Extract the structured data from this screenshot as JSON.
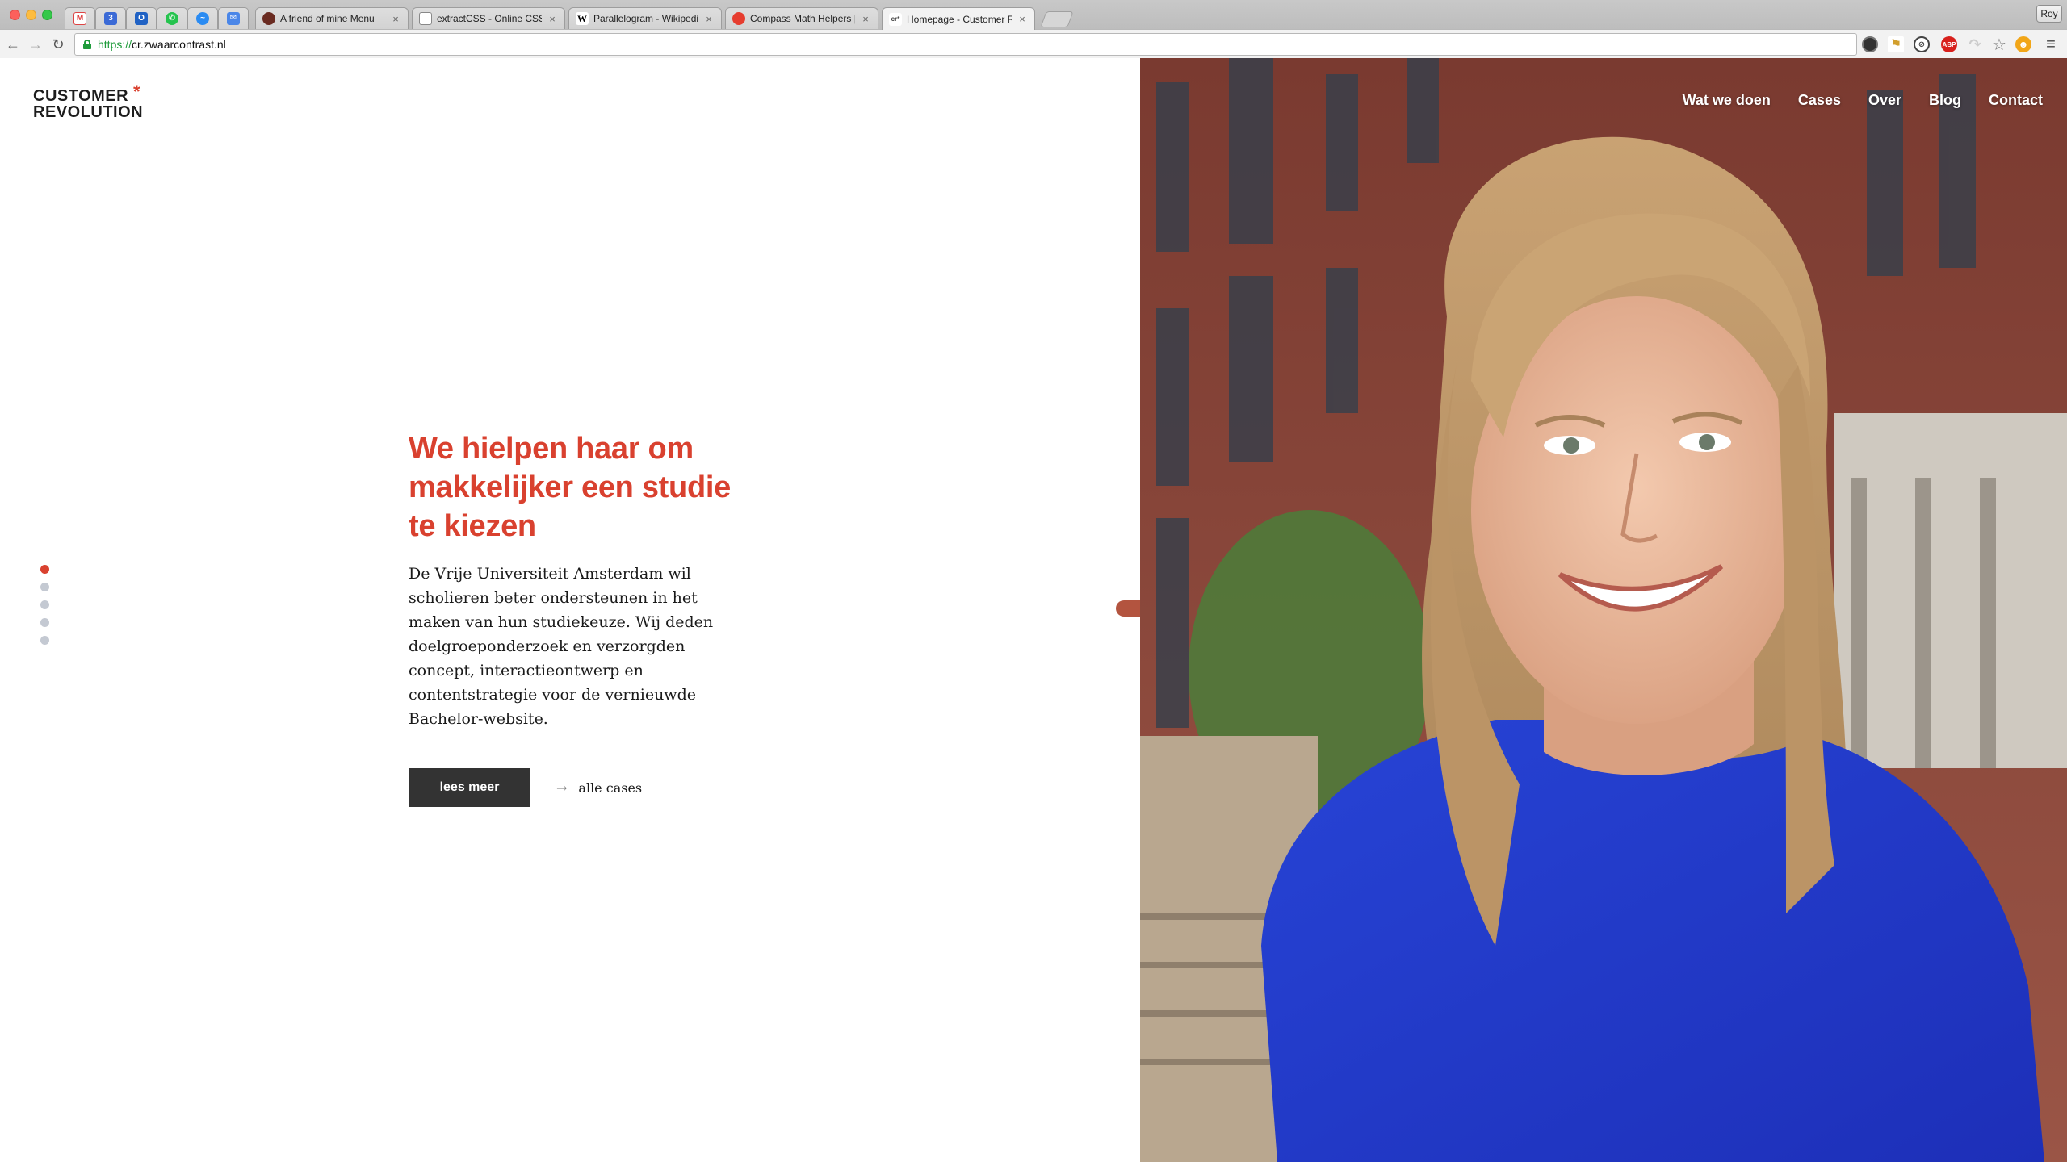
{
  "browser": {
    "pinned_tabs": [
      {
        "icon": "gmail-icon"
      },
      {
        "icon": "calendar-icon"
      },
      {
        "icon": "outlook-icon"
      },
      {
        "icon": "whatsapp-icon"
      },
      {
        "icon": "messenger-icon"
      },
      {
        "icon": "mail-icon"
      }
    ],
    "tabs": [
      {
        "title": "A friend of mine Menu",
        "icon": "friend-icon"
      },
      {
        "title": "extractCSS - Online CSS E",
        "icon": "document-icon"
      },
      {
        "title": "Parallelogram - Wikipedia",
        "icon": "wikipedia-icon"
      },
      {
        "title": "Compass Math Helpers | Co",
        "icon": "compass-icon"
      },
      {
        "title": "Homepage - Customer Re",
        "icon": "cr-icon",
        "active": true
      }
    ],
    "profile": "Roy",
    "url_scheme": "https://",
    "url_host": "cr.zwaarcontrast.nl"
  },
  "site": {
    "logo_line1": "CUSTOMER",
    "logo_line2": "REVOLUTION",
    "logo_star": "*",
    "nav": [
      "Wat we doen",
      "Cases",
      "Over",
      "Blog",
      "Contact"
    ]
  },
  "hero": {
    "heading": "We hielpen haar om makkelijker een studie te kiezen",
    "body": "De Vrije Universiteit Amsterdam wil scholieren beter ondersteunen in het maken van hun studiekeuze.  Wij deden doelgroeponderzoek en verzorgden concept, interactieontwerp en contentstrategie voor de vernieuwde Bachelor-website.",
    "primary_button": "lees meer",
    "secondary_link": "alle cases",
    "slides_total": 5,
    "active_slide": 1
  },
  "colors": {
    "accent": "#d9412f",
    "button_dark": "#333333",
    "dot_inactive": "#c4c9d2"
  }
}
